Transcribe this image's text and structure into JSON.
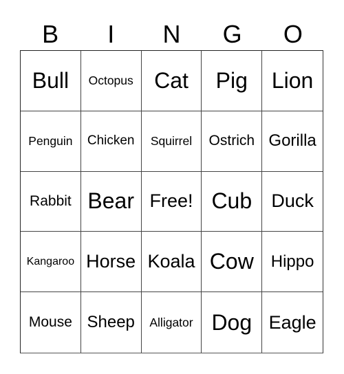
{
  "header": {
    "letters": [
      "B",
      "I",
      "N",
      "G",
      "O"
    ]
  },
  "card": {
    "rows": [
      [
        "Bull",
        "Octopus",
        "Cat",
        "Pig",
        "Lion"
      ],
      [
        "Penguin",
        "Chicken",
        "Squirrel",
        "Ostrich",
        "Gorilla"
      ],
      [
        "Rabbit",
        "Bear",
        "Free!",
        "Cub",
        "Duck"
      ],
      [
        "Kangaroo",
        "Horse",
        "Koala",
        "Cow",
        "Hippo"
      ],
      [
        "Mouse",
        "Sheep",
        "Alligator",
        "Dog",
        "Eagle"
      ]
    ]
  }
}
